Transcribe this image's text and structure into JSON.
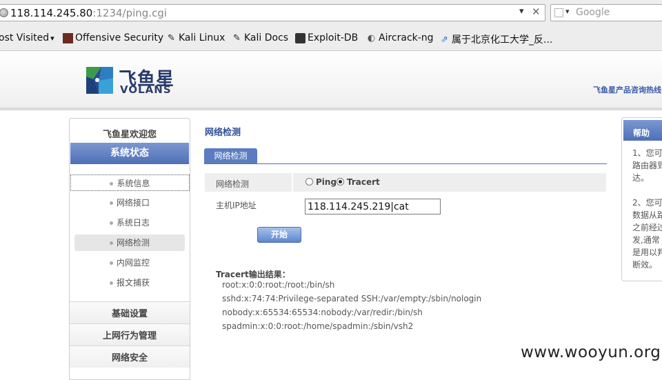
{
  "browser": {
    "url_host": "118.114.245.80",
    "url_rest": ":1234/ping.cgi",
    "search_placeholder": "Google",
    "bookmarks": [
      {
        "label": "ost Visited",
        "icon": "dropdown"
      },
      {
        "label": "Offensive Security",
        "icon": "offsec-icon"
      },
      {
        "label": "Kali Linux",
        "icon": "kali-dragon-icon"
      },
      {
        "label": "Kali Docs",
        "icon": "kali-dragon-icon"
      },
      {
        "label": "Exploit-DB",
        "icon": "exploitdb-icon"
      },
      {
        "label": "Aircrack-ng",
        "icon": "aircrack-icon"
      },
      {
        "label": "属于北京化工大学_反...",
        "icon": "link-icon"
      }
    ]
  },
  "header": {
    "logo_cn": "飞鱼星",
    "logo_en": "VOLANS",
    "hotline": "飞鱼星产品咨询热线"
  },
  "sidebar": {
    "welcome": "飞鱼星欢迎您",
    "section": "系统状态",
    "items": [
      "系统信息",
      "网络接口",
      "系统日志",
      "网络检测",
      "内网监控",
      "报文捕获"
    ],
    "groups": [
      "基础设置",
      "上网行为管理",
      "网络安全"
    ]
  },
  "main": {
    "title": "网络检测",
    "tab": "网络检测",
    "row1_label": "网络检测",
    "radio_ping": "Ping",
    "radio_tracert": "Tracert",
    "selected": "Tracert",
    "host_label": "主机IP地址",
    "host_value": "118.114.245.219|cat",
    "start_button": "开始",
    "result_title": "Tracert输出结果：",
    "result_lines": [
      "root:x:0:0:root:/root:/bin/sh",
      "sshd:x:74:74:Privilege-separated SSH:/var/empty:/sbin/nologin",
      "nobody:x:65534:65534:nobody:/var/redir:/bin/sh",
      "spadmin:x:0:0:root:/home/spadmin:/sbin/vsh2"
    ]
  },
  "help": {
    "title": "帮助",
    "para1": "1、您可路由器到达。",
    "para2": "2、您可数据从路之前经过发,通常是用以判断效。"
  },
  "watermark": "www.wooyun.org",
  "colors": {
    "accent_blue": "#5b7cc0",
    "title_blue": "#2f4f96",
    "logo_navy": "#263a6b"
  }
}
